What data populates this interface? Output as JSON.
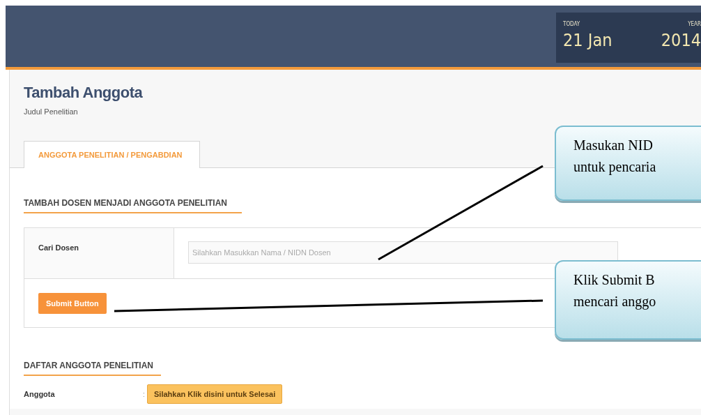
{
  "header": {
    "date": {
      "today_label": "TODAY",
      "today": "21 Jan",
      "year_label": "YEAR",
      "year": "2014"
    }
  },
  "page": {
    "title": "Tambah Anggota",
    "subtitle": "Judul Penelitian"
  },
  "tabs": [
    {
      "label": "ANGGOTA PENELITIAN / PENGABDIAN",
      "selected": true
    }
  ],
  "search_section": {
    "heading": "TAMBAH DOSEN MENJADI ANGGOTA PENELITIAN",
    "field_label": "Cari Dosen",
    "placeholder": "Silahkan Masukkan Nama / NIDN Dosen",
    "button": "Submit Button"
  },
  "members_section": {
    "heading": "DAFTAR ANGGOTA PENELITIAN",
    "label": "Anggota",
    "separator": ":",
    "button": "Silahkan Klik disini untuk Selesai"
  },
  "callouts": [
    {
      "lines": [
        "Masukan NID",
        "untuk pencaria"
      ]
    },
    {
      "lines": [
        "Klik Submit B",
        "mencari anggo"
      ]
    }
  ]
}
